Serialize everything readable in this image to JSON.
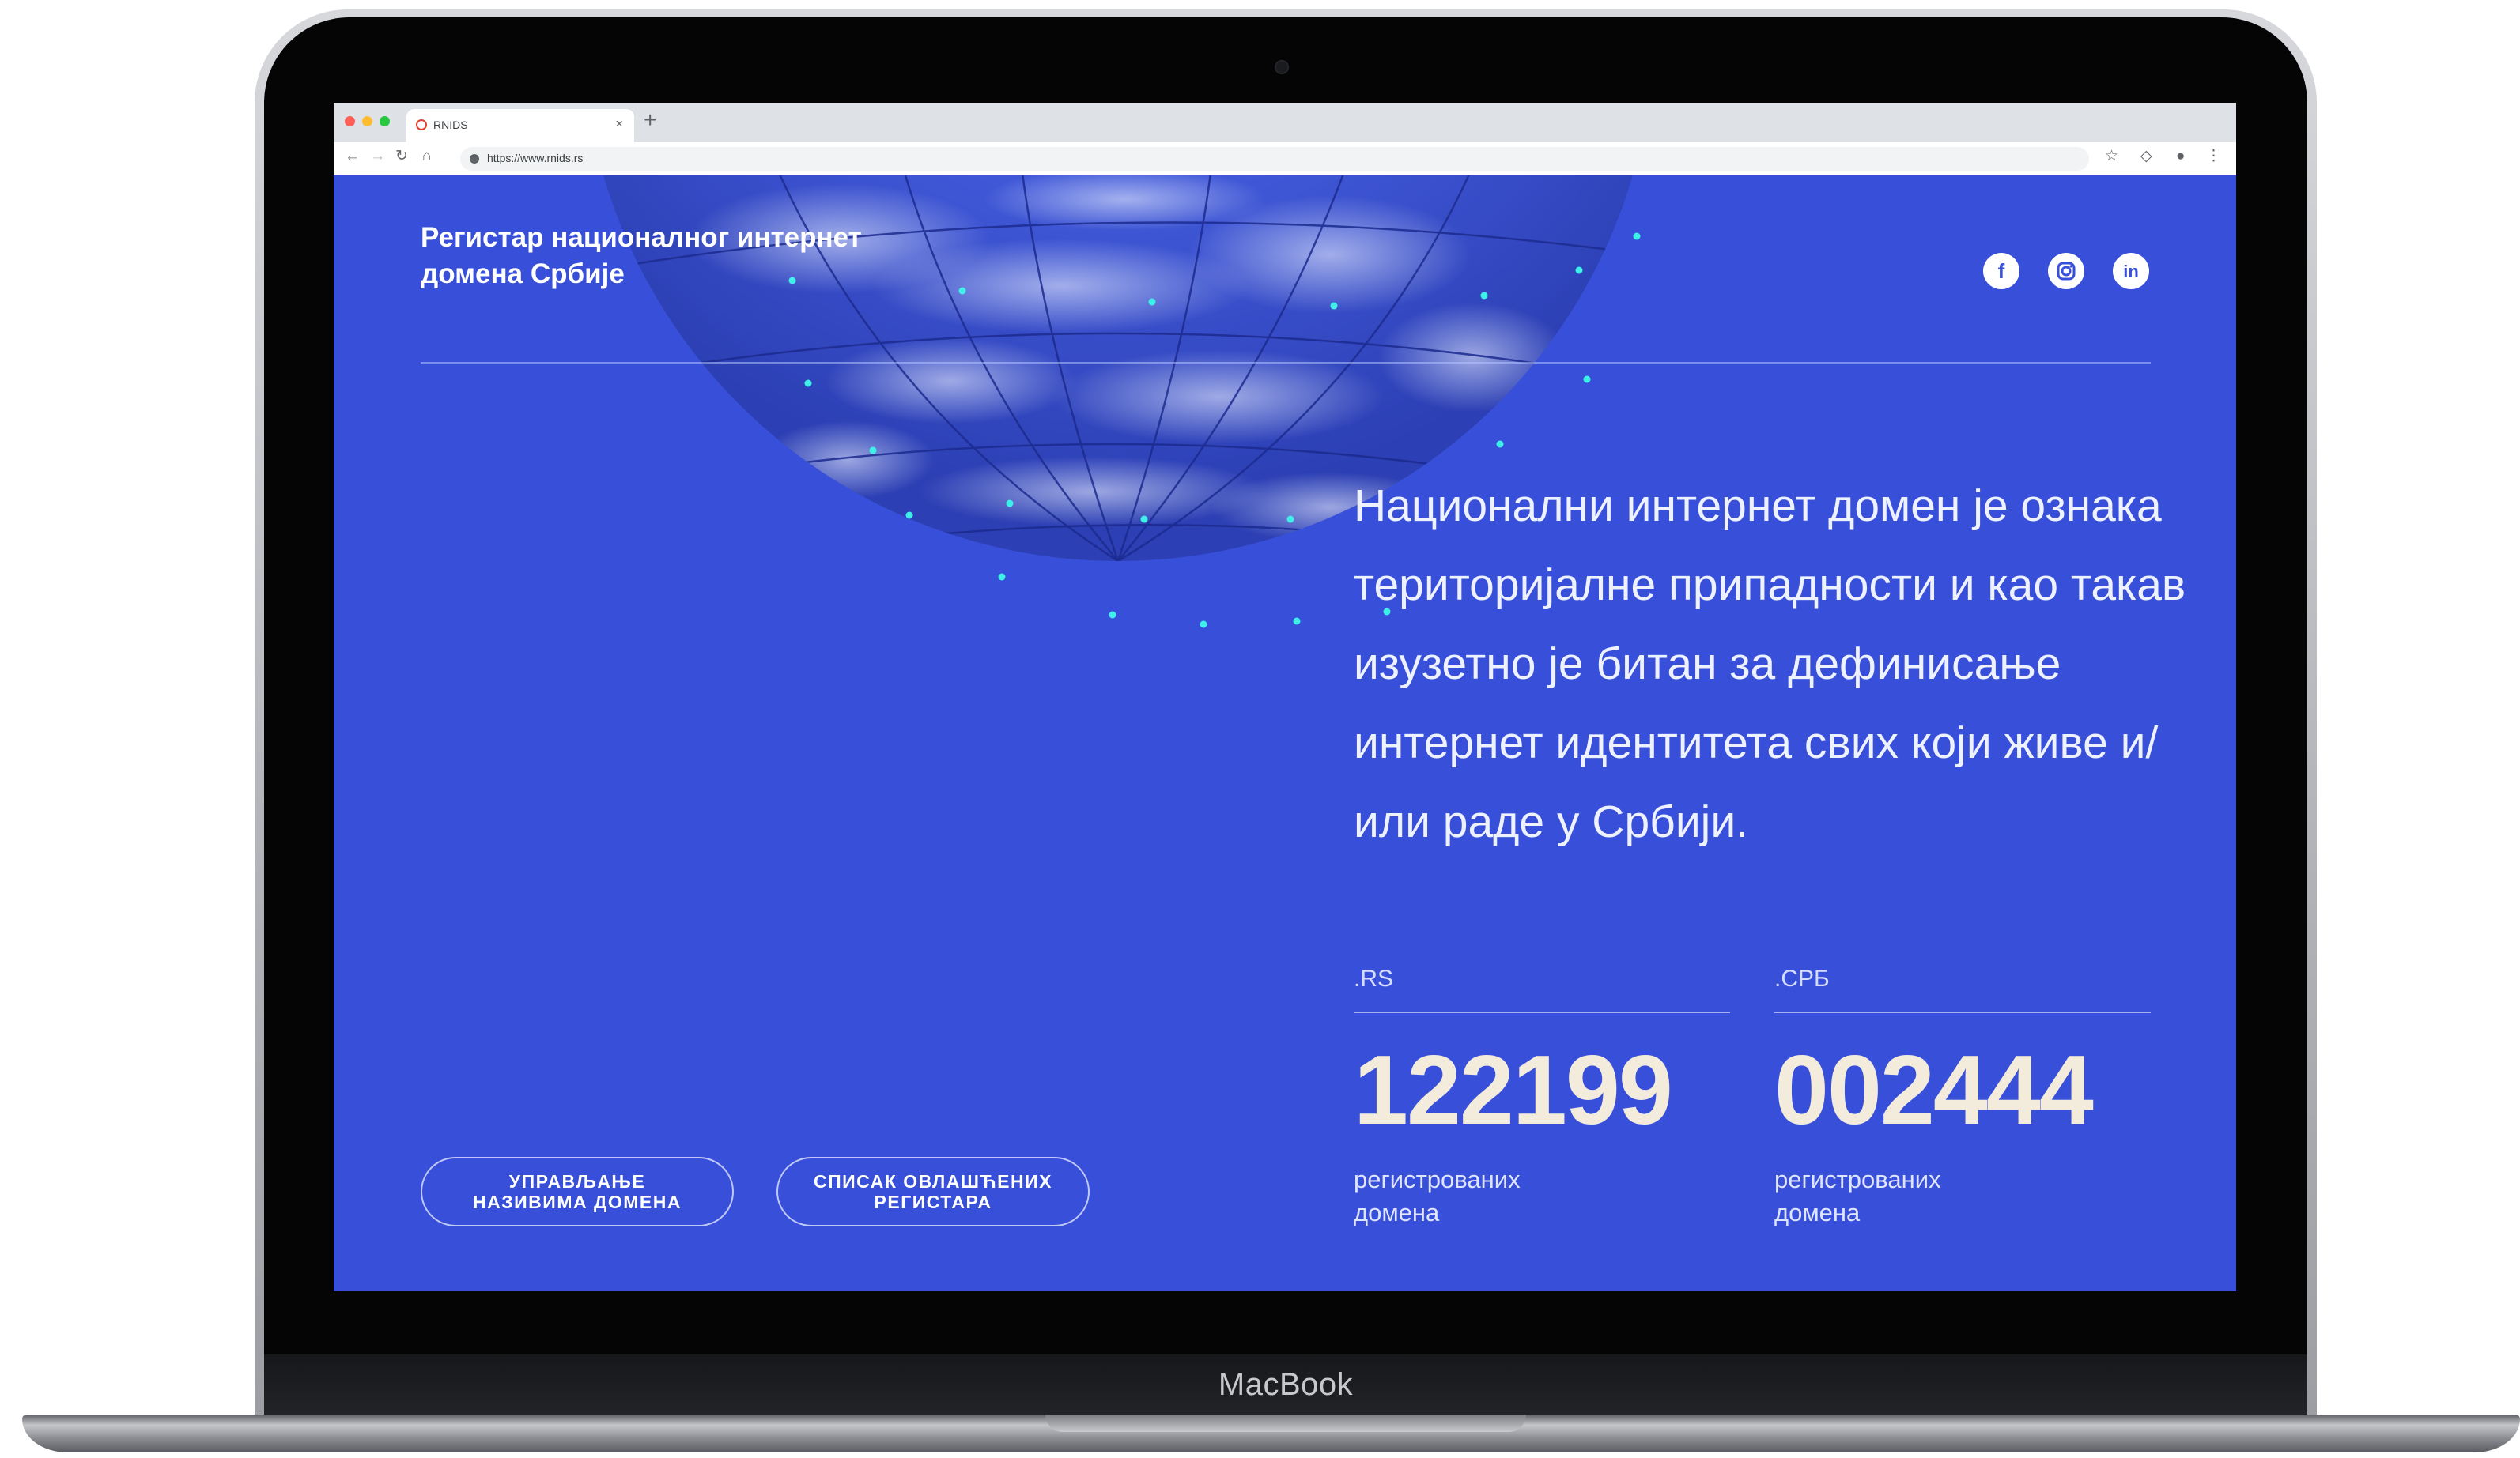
{
  "device": {
    "label": "MacBook"
  },
  "browser": {
    "tab_title": "RNIDS",
    "tab_close": "×",
    "new_tab": "+",
    "url": "https://www.rnids.rs"
  },
  "header": {
    "title": "Регистар националног интернет домена Србије",
    "social": [
      "facebook-icon",
      "instagram-icon",
      "linkedin-icon"
    ]
  },
  "intro": "Национални интернет домен је ознака територијалне припадности и као такав изузетно је битан за дефинисање интернет идентитета свих који живе и/или раде у Србији.",
  "stats": [
    {
      "label": ".RS",
      "value": "122199",
      "description": "регистрованих домена"
    },
    {
      "label": ".СРБ",
      "value": "002444",
      "description": "регистрованих домена"
    }
  ],
  "buttons": {
    "manage": "УПРАВЉАЊЕ\nНАЗИВИМА ДОМЕНА",
    "registrars": "СПИСАК ОВЛАШЋЕНИХ\nРЕГИСТАРА"
  },
  "colors": {
    "page_background": "#3850d9",
    "grid_dot": "#3ef0e8",
    "stat_number": "#f3ecdc"
  }
}
